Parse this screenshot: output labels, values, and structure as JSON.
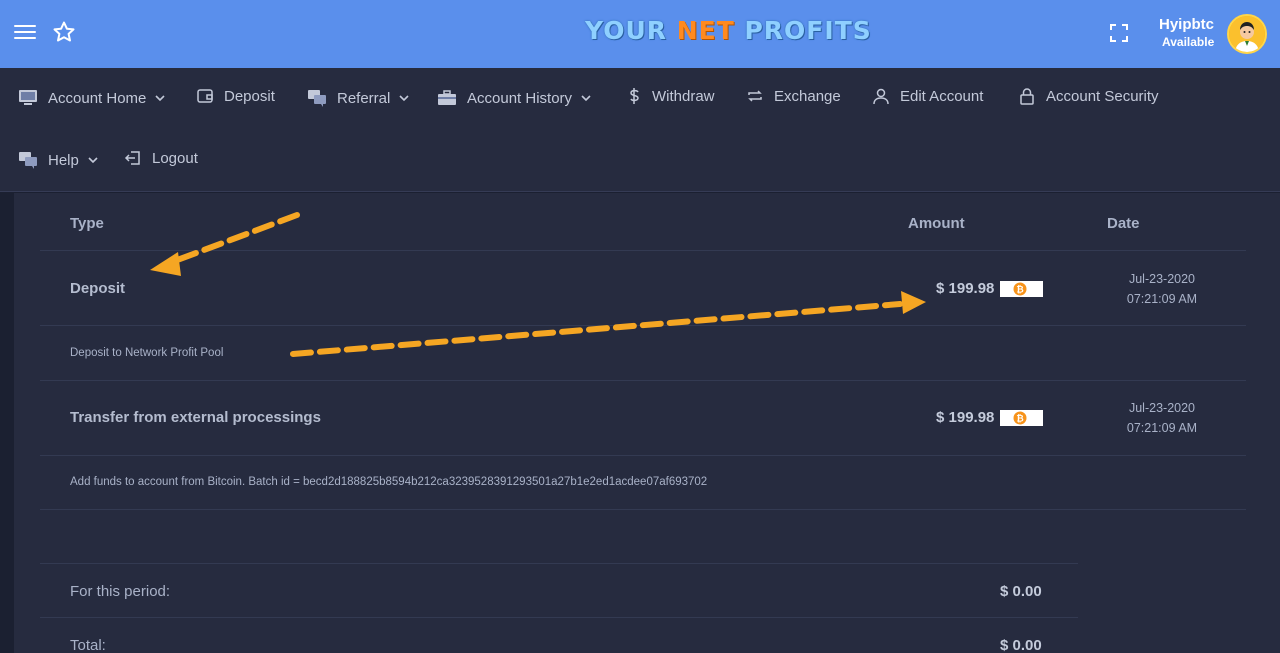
{
  "header": {
    "logo_part1": "YOUR ",
    "logo_part2": "NET",
    "logo_part3": " PROFITS",
    "username": "Hyipbtc",
    "status": "Available"
  },
  "nav": {
    "account_home": "Account Home",
    "deposit": "Deposit",
    "referral": "Referral",
    "account_history": "Account History",
    "withdraw": "Withdraw",
    "exchange": "Exchange",
    "edit_account": "Edit Account",
    "account_security": "Account Security",
    "help": "Help",
    "logout": "Logout"
  },
  "table": {
    "columns": [
      "Type",
      "Amount",
      "Date"
    ],
    "rows": [
      {
        "type": "Deposit",
        "amount": "$ 199.98",
        "date": "Jul-23-2020",
        "time": "07:21:09 AM",
        "description": "Deposit to Network Profit Pool"
      },
      {
        "type": "Transfer from external processings",
        "amount": "$ 199.98",
        "date": "Jul-23-2020",
        "time": "07:21:09 AM",
        "description": "Add funds to account from Bitcoin. Batch id = becd2d188825b8594b212ca3239528391293501a27b1e2ed1acdee07af693702"
      }
    ]
  },
  "summary": {
    "period_label": "For this period:",
    "period_value": "$ 0.00",
    "total_label": "Total:",
    "total_value": "$ 0.00"
  },
  "colors": {
    "topbar": "#5a8fec",
    "nav": "#262b3f",
    "panel": "#262b3f",
    "arrow": "#f5a623",
    "bitcoin": "#f7931a"
  }
}
